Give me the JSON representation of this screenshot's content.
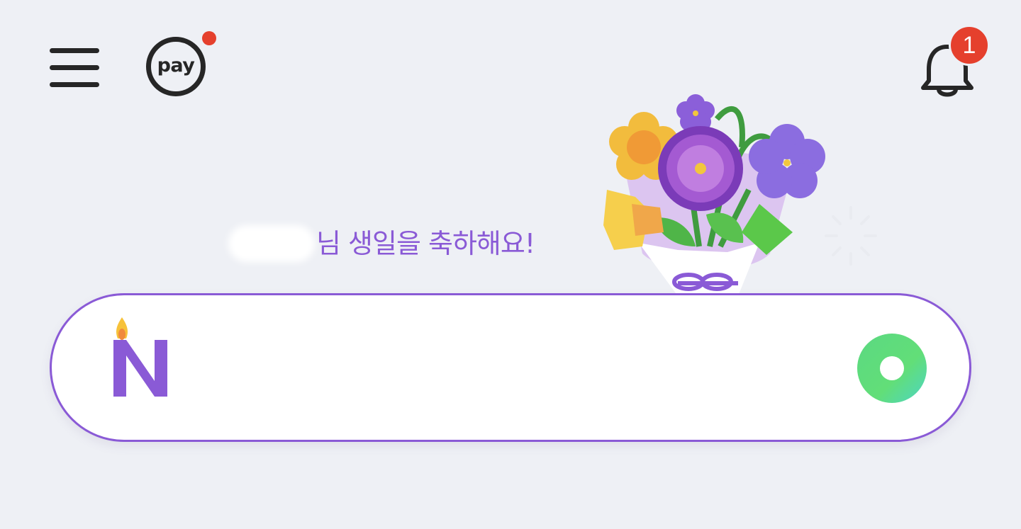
{
  "header": {
    "menu_icon": "hamburger-menu-icon",
    "pay_logo_text": "pay",
    "pay_new_indicator_color": "#e5402d",
    "bell_icon": "bell-icon",
    "notification_count": "1"
  },
  "greeting": {
    "user_name": "",
    "message": "님 생일을 축하해요!",
    "decoration_icon": "flower-bouquet-icon"
  },
  "search": {
    "logo_icon": "birthday-candle-n-logo-icon",
    "input_value": "",
    "placeholder": "",
    "action_icon": "green-ring-button-icon"
  },
  "colors": {
    "background": "#eef0f5",
    "accent_purple": "#8a5ad6",
    "badge_red": "#e5402d",
    "green": "#5bd982"
  }
}
